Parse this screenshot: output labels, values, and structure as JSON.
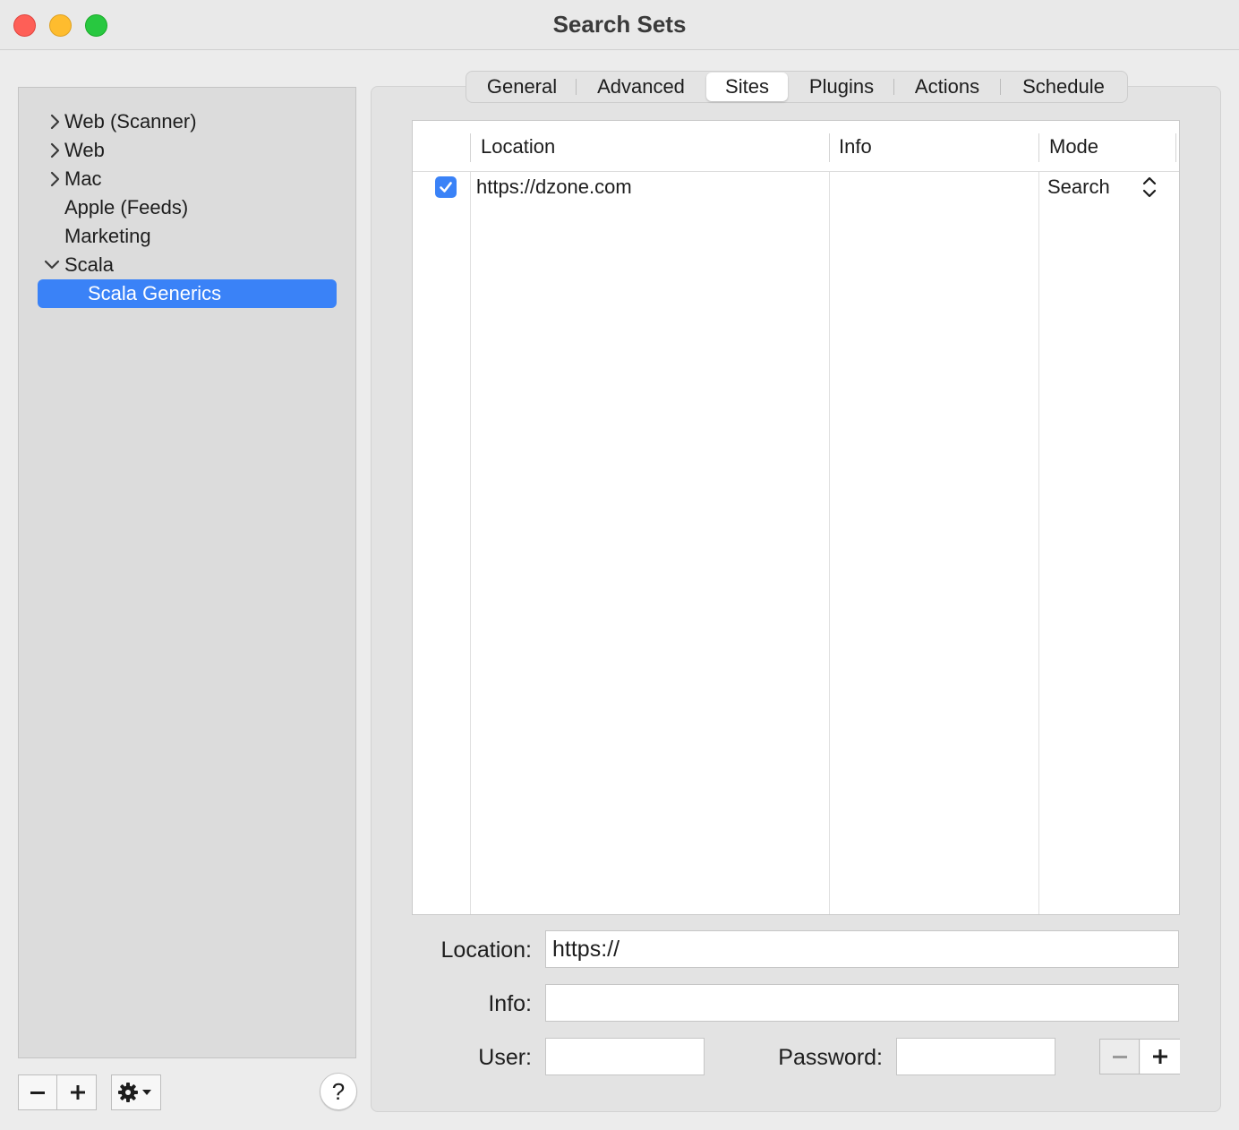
{
  "window": {
    "title": "Search Sets"
  },
  "sidebar": {
    "items": [
      {
        "label": "Web (Scanner)",
        "expandable": true,
        "expanded": false
      },
      {
        "label": "Web",
        "expandable": true,
        "expanded": false
      },
      {
        "label": "Mac",
        "expandable": true,
        "expanded": false
      },
      {
        "label": "Apple (Feeds)",
        "expandable": false
      },
      {
        "label": "Marketing",
        "expandable": false
      },
      {
        "label": "Scala",
        "expandable": true,
        "expanded": true
      },
      {
        "label": "Scala Generics",
        "child": true,
        "selected": true
      }
    ],
    "remove_icon": "minus-icon",
    "add_icon": "plus-icon",
    "action_icon": "gear-icon",
    "help_label": "?"
  },
  "tabs": [
    {
      "label": "General",
      "active": false
    },
    {
      "label": "Advanced",
      "active": false
    },
    {
      "label": "Sites",
      "active": true
    },
    {
      "label": "Plugins",
      "active": false
    },
    {
      "label": "Actions",
      "active": false
    },
    {
      "label": "Schedule",
      "active": false
    }
  ],
  "sites_table": {
    "columns": [
      "Location",
      "Info",
      "Mode"
    ],
    "rows": [
      {
        "enabled": true,
        "location": "https://dzone.com",
        "info": "",
        "mode": "Search"
      }
    ]
  },
  "form": {
    "location_label": "Location:",
    "location_value": "https://",
    "info_label": "Info:",
    "info_value": "",
    "user_label": "User:",
    "user_value": "",
    "password_label": "Password:",
    "password_value": ""
  },
  "colors": {
    "selection": "#3a82f7",
    "close": "#fe5f57",
    "minimize": "#febc2e",
    "maximize": "#28c840"
  }
}
